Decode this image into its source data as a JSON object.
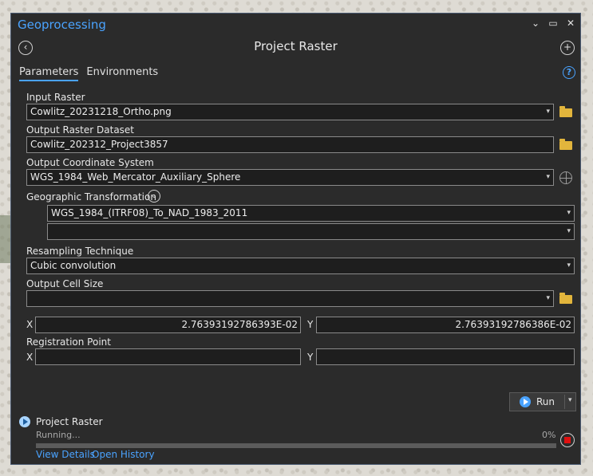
{
  "window": {
    "title": "Geoprocessing",
    "tool_title": "Project Raster"
  },
  "tabs": [
    {
      "label": "Parameters",
      "active": true
    },
    {
      "label": "Environments",
      "active": false
    }
  ],
  "params": {
    "input_raster": {
      "label": "Input Raster",
      "value": "Cowlitz_20231218_Ortho.png"
    },
    "output_raster": {
      "label": "Output Raster Dataset",
      "value": "Cowlitz_202312_Project3857"
    },
    "output_cs": {
      "label": "Output Coordinate System",
      "value": "WGS_1984_Web_Mercator_Auxiliary_Sphere"
    },
    "geo_transform": {
      "label": "Geographic Transformation",
      "value1": "WGS_1984_(ITRF08)_To_NAD_1983_2011",
      "value2": ""
    },
    "resampling": {
      "label": "Resampling Technique",
      "value": "Cubic convolution"
    },
    "cell_size": {
      "label": "Output Cell Size",
      "value": "",
      "x_label": "X",
      "y_label": "Y",
      "x": "2.76393192786393E-02",
      "y": "2.76393192786386E-02"
    },
    "registration": {
      "label": "Registration Point",
      "x_label": "X",
      "y_label": "Y",
      "x": "",
      "y": ""
    }
  },
  "run": {
    "label": "Run"
  },
  "status": {
    "tool": "Project Raster",
    "state": "Running...",
    "percent_text": "0%",
    "progress": 0.0,
    "view_details": "View Details",
    "open_history": "Open History"
  },
  "colors": {
    "accent": "#4aa3ff",
    "panel_bg": "#2b2b2b",
    "stop": "#e01010",
    "folder": "#e2b53c"
  },
  "icons": [
    "back-arrow-icon",
    "add-icon",
    "help-icon",
    "folder-icon",
    "globe-icon",
    "chevron-down-icon",
    "run-icon",
    "stop-icon"
  ]
}
